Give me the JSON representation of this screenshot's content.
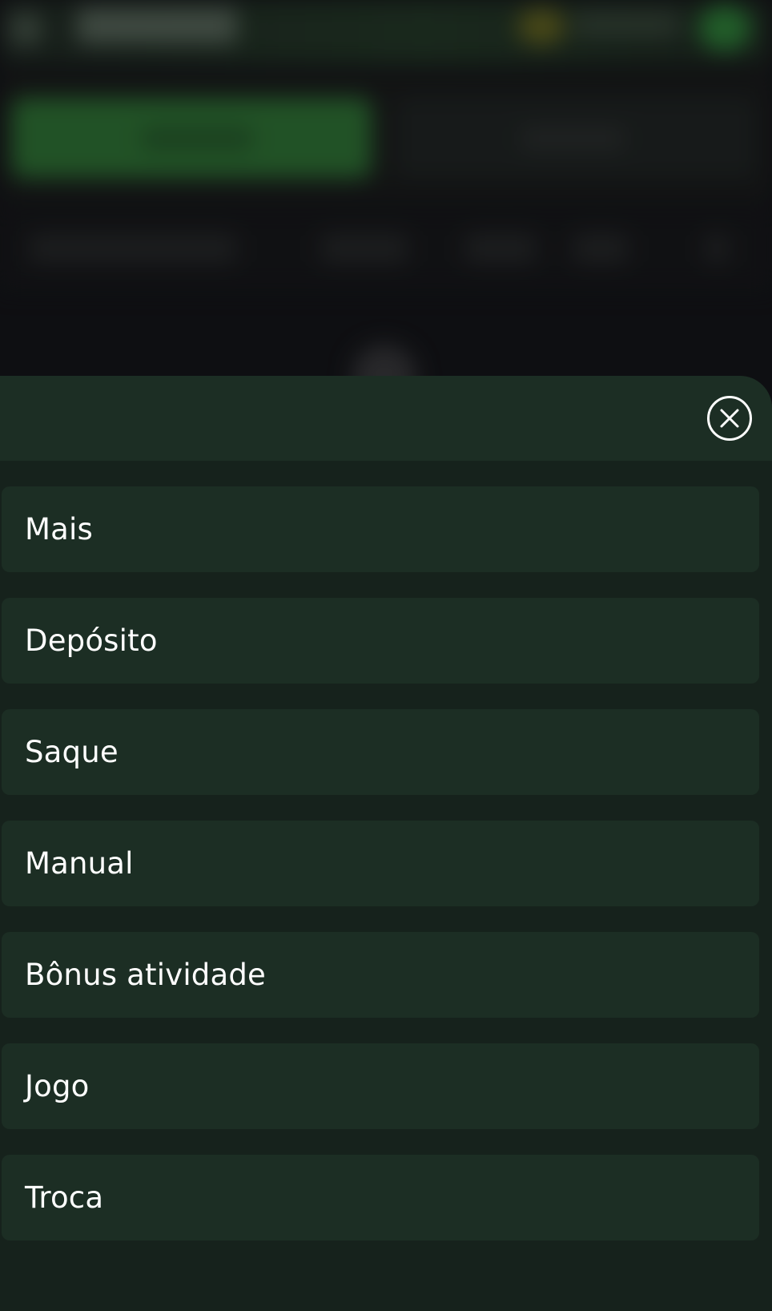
{
  "sheet": {
    "close_icon": "close-circle-icon",
    "options": [
      {
        "label": "Mais"
      },
      {
        "label": "Depósito"
      },
      {
        "label": "Saque"
      },
      {
        "label": "Manual"
      },
      {
        "label": "Bônus atividade"
      },
      {
        "label": "Jogo"
      },
      {
        "label": "Troca"
      }
    ]
  },
  "colors": {
    "sheet_background": "#16221c",
    "option_background": "#1c2e24",
    "text": "#ffffff",
    "accent_green": "#2f7a35"
  }
}
